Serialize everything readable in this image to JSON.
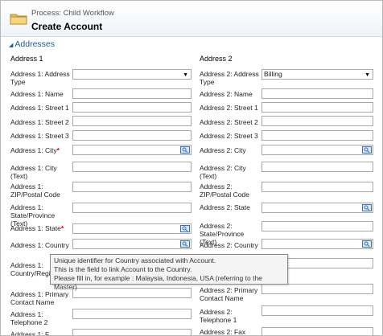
{
  "header": {
    "process_label": "Process: Child Workflow",
    "title": "Create Account"
  },
  "section": {
    "title": "Addresses"
  },
  "columns": {
    "left": "Address 1",
    "right": "Address 2"
  },
  "left_fields": [
    {
      "label": "Address 1: Address Type",
      "type": "select",
      "value": "",
      "required": false
    },
    {
      "label": "Address 1: Name",
      "type": "text",
      "value": "",
      "required": false
    },
    {
      "label": "Address 1: Street 1",
      "type": "text",
      "value": "",
      "required": false
    },
    {
      "label": "Address 1: Street 2",
      "type": "text",
      "value": "",
      "required": false
    },
    {
      "label": "Address 1: Street 3",
      "type": "text",
      "value": "",
      "required": false
    },
    {
      "label": "Address 1: City",
      "type": "lookup",
      "value": "",
      "required": true
    },
    {
      "label": "Address 1: City (Text)",
      "type": "text",
      "value": "",
      "required": false
    },
    {
      "label": "Address 1: ZIP/Postal Code",
      "type": "text",
      "value": "",
      "required": false
    },
    {
      "label": "Address 1: State/Province (Text)",
      "type": "text",
      "value": "",
      "required": false
    },
    {
      "label": "Address 1: State",
      "type": "lookup",
      "value": "",
      "required": true
    },
    {
      "label": "Address 1: Country",
      "type": "lookup",
      "value": "",
      "required": false
    },
    {
      "label": "Address 1: Country/Regi",
      "type": "text",
      "value": "",
      "required": true
    },
    {
      "label": "Address 1: Primary Contact Name",
      "type": "text",
      "value": "",
      "required": false
    },
    {
      "label": "Address 1: Telephone 2",
      "type": "text",
      "value": "",
      "required": false
    },
    {
      "label": "Address 1: F",
      "type": "text",
      "value": "",
      "required": false
    }
  ],
  "right_fields": [
    {
      "label": "Address 2: Address Type",
      "type": "select",
      "value": "Billing",
      "required": false
    },
    {
      "label": "Address 2: Name",
      "type": "text",
      "value": "",
      "required": false
    },
    {
      "label": "Address 2: Street 1",
      "type": "text",
      "value": "",
      "required": false
    },
    {
      "label": "Address 2: Street 2",
      "type": "text",
      "value": "",
      "required": false
    },
    {
      "label": "Address 2: Street 3",
      "type": "text",
      "value": "",
      "required": false
    },
    {
      "label": "Address 2: City",
      "type": "lookup",
      "value": "",
      "required": false
    },
    {
      "label": "Address 2: City (Text)",
      "type": "text",
      "value": "",
      "required": false
    },
    {
      "label": "Address 2: ZIP/Postal Code",
      "type": "text",
      "value": "",
      "required": false
    },
    {
      "label": "Address 2: State",
      "type": "lookup",
      "value": "",
      "required": false
    },
    {
      "label": "Address 2: State/Province (Text)",
      "type": "text",
      "value": "",
      "required": false
    },
    {
      "label": "Address 2: Country",
      "type": "lookup",
      "value": "",
      "required": false
    },
    {
      "label": "",
      "type": "text",
      "value": "",
      "required": false
    },
    {
      "label": "Address 2: Primary Contact Name",
      "type": "text",
      "value": "",
      "required": false
    },
    {
      "label": "Address 2: Telephone 1",
      "type": "text",
      "value": "",
      "required": false
    },
    {
      "label": "Address 2: Fax",
      "type": "text",
      "value": "",
      "required": false
    }
  ],
  "tooltip": {
    "line1": "Unique identifier for Country associated with Account.",
    "line2": "This is the field to link Account to the Country.",
    "line3": "Please fill in, for example : Malaysia, Indonesia, USA (referring to the Master)"
  },
  "colors": {
    "section_link": "#1f5a94",
    "required_marker": "#e00000",
    "lookup_icon": "#3a6fb5"
  }
}
